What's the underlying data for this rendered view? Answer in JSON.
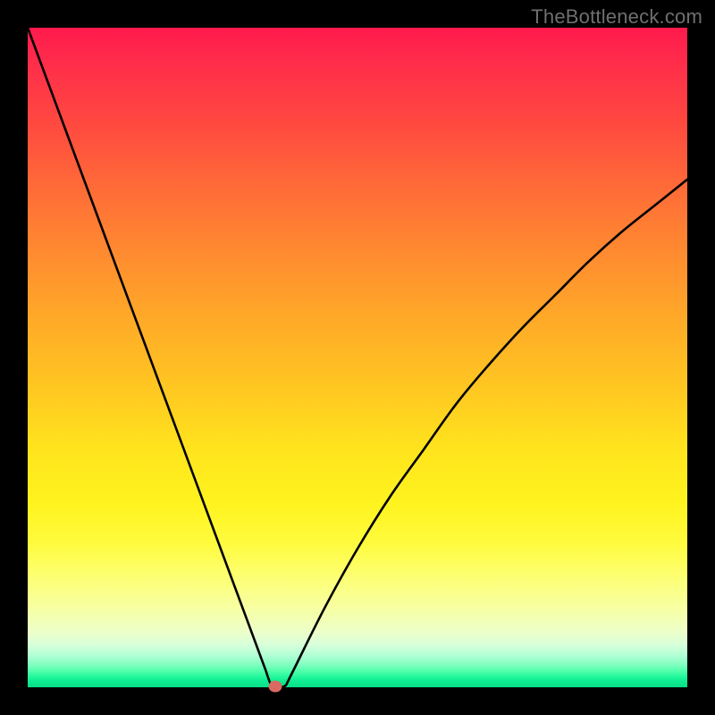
{
  "watermark": "TheBottleneck.com",
  "colors": {
    "frame": "#000000",
    "curve": "#000000",
    "marker": "#d96a62",
    "gradient_top": "#ff1a4d",
    "gradient_bottom": "#08de89"
  },
  "chart_data": {
    "type": "line",
    "title": "",
    "xlabel": "",
    "ylabel": "",
    "xlim": [
      0,
      100
    ],
    "ylim": [
      0,
      100
    ],
    "grid": false,
    "legend": false,
    "description": "V-shaped bottleneck curve on a red-to-green vertical gradient background. The curve descends steeply from the top-left, reaches a flat minimum near x≈37, then rises with a concave (sqrt-like) shape toward the right, ending around y≈77 at x=100. A small red-brown marker sits at the curve minimum.",
    "series": [
      {
        "name": "bottleneck-curve",
        "x": [
          0,
          5,
          10,
          15,
          20,
          25,
          30,
          33,
          35,
          36,
          37,
          38,
          39,
          40,
          45,
          50,
          55,
          60,
          65,
          70,
          75,
          80,
          85,
          90,
          95,
          100
        ],
        "y": [
          100,
          86.5,
          73,
          59.5,
          46,
          32.5,
          19,
          10.9,
          5.5,
          2.8,
          0.2,
          0.2,
          0.2,
          2,
          12,
          21,
          29,
          36,
          43,
          49,
          54.5,
          59.5,
          64.5,
          69,
          73,
          77
        ]
      }
    ],
    "marker": {
      "x": 37.5,
      "y": 0.2
    }
  }
}
